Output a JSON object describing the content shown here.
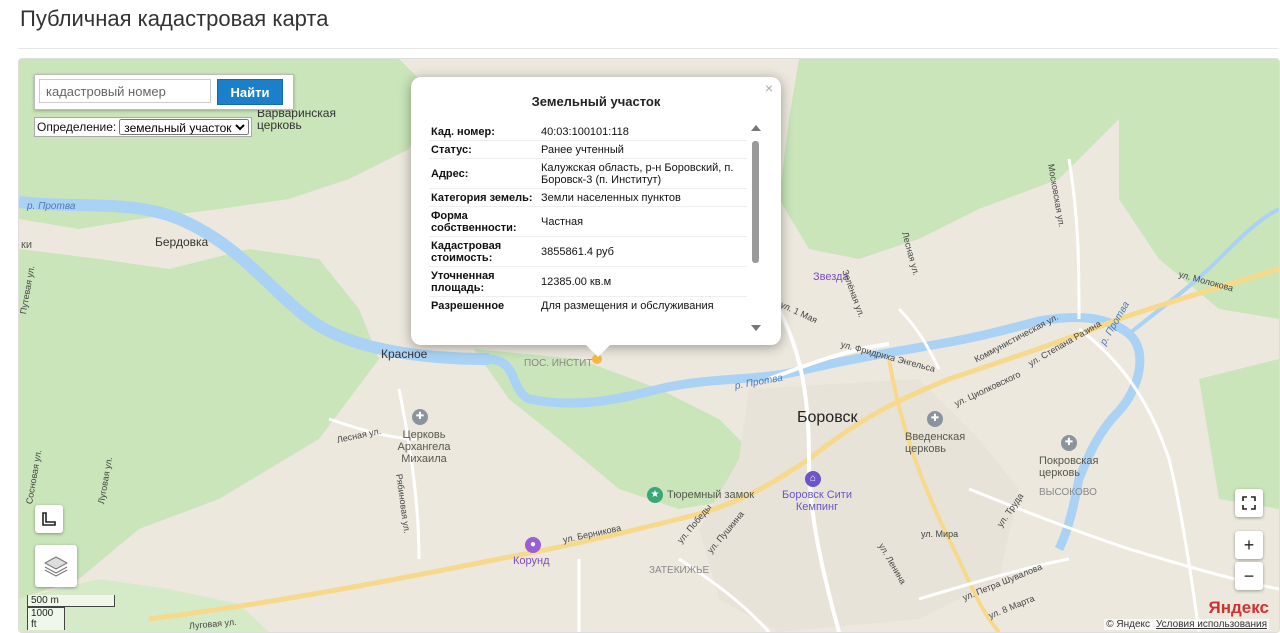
{
  "page": {
    "title": "Публичная кадастровая карта"
  },
  "search": {
    "placeholder": "кадастровый номер",
    "button": "Найти"
  },
  "definition": {
    "label": "Определение:",
    "selected": "земельный участок"
  },
  "popup": {
    "title": "Земельный участок",
    "close": "×",
    "rows": [
      {
        "key": "Кад. номер",
        "value": "40:03:100101:118"
      },
      {
        "key": "Статус",
        "value": "Ранее учтенный"
      },
      {
        "key": "Адрес",
        "value": "Калужская область, р-н Боровский, п. Боровск-3 (п. Институт)"
      },
      {
        "key": "Категория земель",
        "value": "Земли населенных пунктов"
      },
      {
        "key": "Форма собственности",
        "value": "Частная"
      },
      {
        "key": "Кадастровая стоимость",
        "value": "3855861.4 руб"
      },
      {
        "key": "Уточненная площадь",
        "value": "12385.00 кв.м"
      },
      {
        "key": "Разрешенное",
        "value": "Для размещения и обслуживания"
      }
    ]
  },
  "map": {
    "labels": {
      "varvarinskaya": "Варваринская церковь",
      "berdovka": "Бердовка",
      "krasnoe": "Красное",
      "pos_instit": "ПОС. ИНСТИТ",
      "borovsk": "Боровск",
      "zvezda": "Звезда",
      "church_arkh": "Церковь Архангела Михаила",
      "church_vved": "Введенская церковь",
      "church_pokr": "Покровская церковь",
      "vysokovo": "ВЫСОКОВО",
      "zamok": "Тюремный замок",
      "camping": "Боровск Сити Кемпинг",
      "korund": "Корунд",
      "zatekizhe": "ЗАТЕКИЖЬЕ",
      "protva1": "р. Протва",
      "protva2": "р. Протва",
      "protva3": "р. Протва",
      "ki": "ки",
      "st_berniko": "ул. Берникова",
      "st_kommun": "Коммунистическая ул.",
      "st_engels": "ул. Фридриха Энгельса",
      "st_molokova": "ул. Молокова",
      "st_razina": "ул. Степана Разина",
      "st_ciolk": "ул. Циолковского",
      "st_mira": "ул. Мира",
      "st_lenina": "ул. Ленина",
      "st_shuvalova": "ул. Петра Шувалова",
      "st_8marta": "ул. 8 Марта",
      "st_trudа": "ул. Труда",
      "st_pobedy": "ул. Победы",
      "st_pushkina": "ул. Пушкина",
      "st_lesnaya": "Лесная ул.",
      "st_lesnaya2": "Лесная ул.",
      "st_ryabinovaya": "Рябиновая ул.",
      "st_lugovaya": "Луговая ул.",
      "st_lugovaya2": "Луговая ул.",
      "st_sosnovaya": "Сосновая ул.",
      "st_putevaya": "Путевая ул.",
      "st_zelenaya": "Зелёная ул.",
      "st_moskovskaya": "Московская ул.",
      "st_1maya": "ул. 1 Мая"
    },
    "scale": {
      "metric": "500 m",
      "imperial": "1000 ft"
    },
    "attribution": "© Яндекс",
    "terms": "Условия использования",
    "logo": "Яндекс",
    "zoom_in": "+",
    "zoom_out": "−",
    "colors": {
      "water": "#a9d2f5",
      "forest": "#c9e5b9",
      "road": "#f7d98c",
      "background": "#ece8de"
    }
  }
}
